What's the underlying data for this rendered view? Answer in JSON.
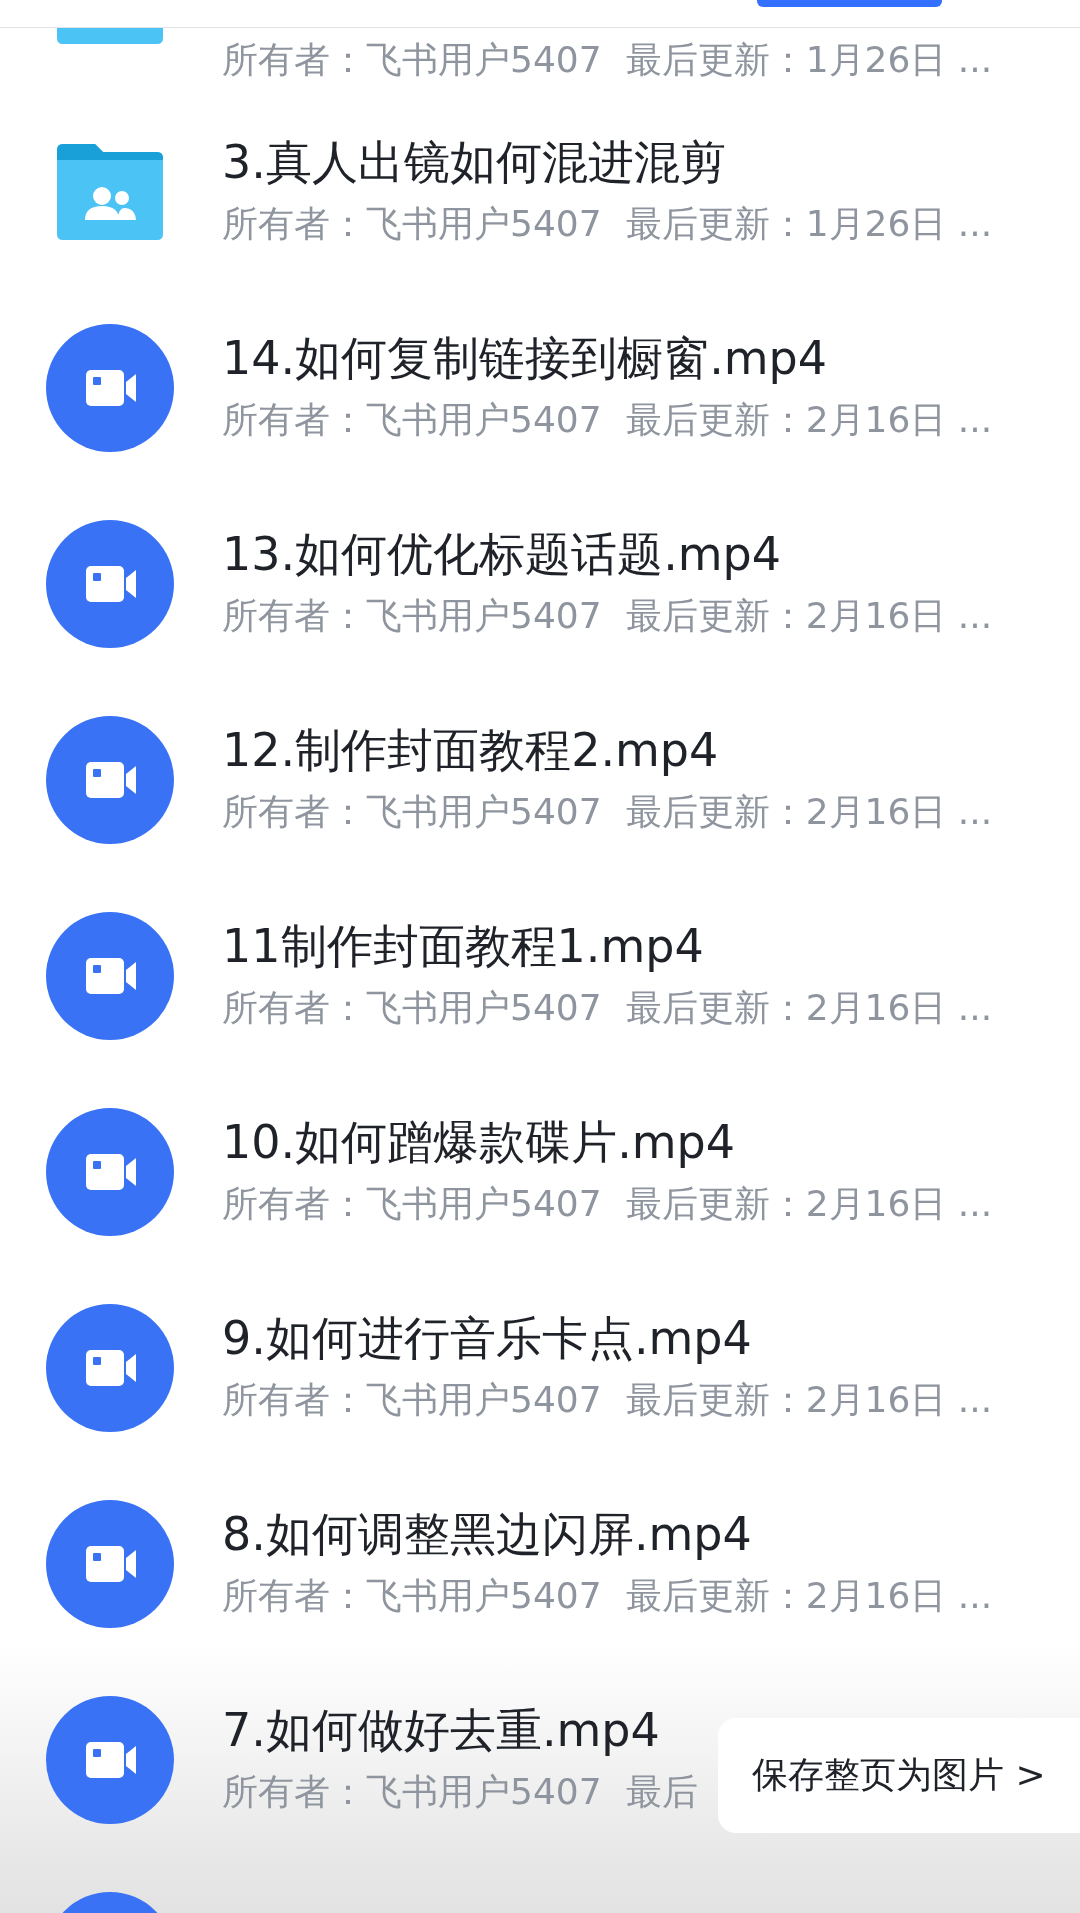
{
  "files": [
    {
      "kind": "folder",
      "owner": "所有者：飞书用户5407",
      "updated": "最后更新：1月26日 ..."
    },
    {
      "kind": "folder",
      "title": "3.真人出镜如何混进混剪",
      "owner": "所有者：飞书用户5407",
      "updated": "最后更新：1月26日 ..."
    },
    {
      "kind": "video",
      "title": "14.如何复制链接到橱窗.mp4",
      "owner": "所有者：飞书用户5407",
      "updated": "最后更新：2月16日 ..."
    },
    {
      "kind": "video",
      "title": "13.如何优化标题话题.mp4",
      "owner": "所有者：飞书用户5407",
      "updated": "最后更新：2月16日 ..."
    },
    {
      "kind": "video",
      "title": "12.制作封面教程2.mp4",
      "owner": "所有者：飞书用户5407",
      "updated": "最后更新：2月16日 ..."
    },
    {
      "kind": "video",
      "title": "11制作封面教程1.mp4",
      "owner": "所有者：飞书用户5407",
      "updated": "最后更新：2月16日 ..."
    },
    {
      "kind": "video",
      "title": "10.如何蹭爆款碟片.mp4",
      "owner": "所有者：飞书用户5407",
      "updated": "最后更新：2月16日 ..."
    },
    {
      "kind": "video",
      "title": "9.如何进行音乐卡点.mp4",
      "owner": "所有者：飞书用户5407",
      "updated": "最后更新：2月16日 ..."
    },
    {
      "kind": "video",
      "title": "8.如何调整黑边闪屏.mp4",
      "owner": "所有者：飞书用户5407",
      "updated": "最后更新：2月16日 ..."
    },
    {
      "kind": "video",
      "title": "7.如何做好去重.mp4",
      "owner": "所有者：飞书用户5407",
      "updated": "最后"
    },
    {
      "kind": "video"
    }
  ],
  "save_page_popup": {
    "label": "保存整页为图片 >"
  }
}
